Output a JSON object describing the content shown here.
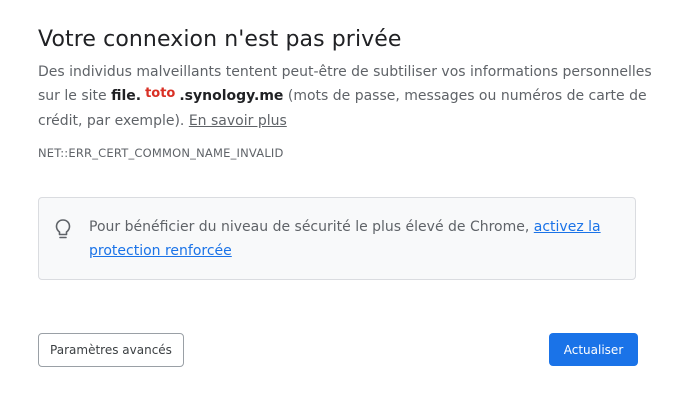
{
  "page": {
    "title": "Votre connexion n'est pas privée",
    "description": {
      "part1": "Des individus malveillants tentent peut-être de subtiliser vos informations personnelles sur le site ",
      "host_prefix": "file.",
      "redaction_text": "toto",
      "host_suffix": ".synology.me",
      "part2": " (mots de passe, messages ou numéros de carte de crédit, par exemple). ",
      "learn_more": "En savoir plus"
    },
    "error_code": "NET::ERR_CERT_COMMON_NAME_INVALID",
    "tip": {
      "icon": "lightbulb-icon",
      "text": "Pour bénéficier du niveau de sécurité le plus élevé de Chrome, ",
      "link": "activez la protection renforcée"
    },
    "buttons": {
      "advanced_label": "Paramètres avancés",
      "reload_label": "Actualiser"
    }
  },
  "colors": {
    "accent": "#1a73e8",
    "text_primary": "#202124",
    "text_secondary": "#5f6368",
    "redaction": "#d93025"
  }
}
